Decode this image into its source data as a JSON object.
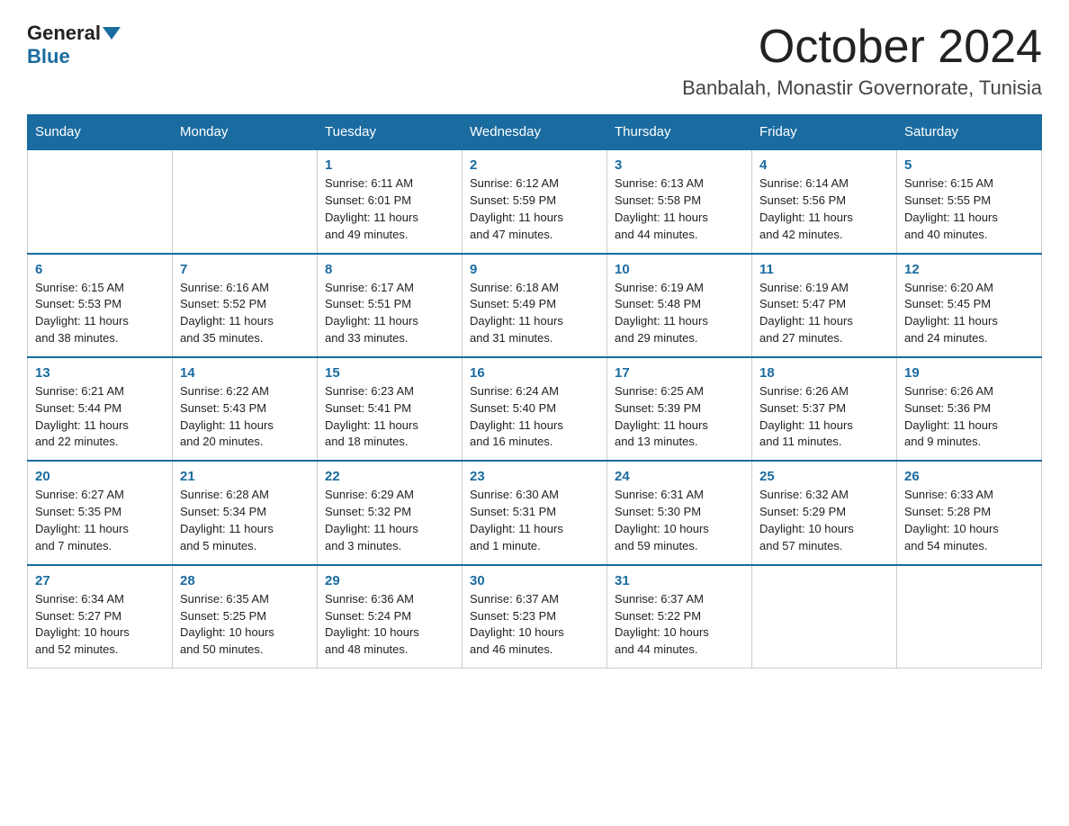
{
  "logo": {
    "general": "General",
    "blue": "Blue"
  },
  "title": "October 2024",
  "location": "Banbalah, Monastir Governorate, Tunisia",
  "days_of_week": [
    "Sunday",
    "Monday",
    "Tuesday",
    "Wednesday",
    "Thursday",
    "Friday",
    "Saturday"
  ],
  "weeks": [
    [
      {
        "num": "",
        "info": ""
      },
      {
        "num": "",
        "info": ""
      },
      {
        "num": "1",
        "info": "Sunrise: 6:11 AM\nSunset: 6:01 PM\nDaylight: 11 hours\nand 49 minutes."
      },
      {
        "num": "2",
        "info": "Sunrise: 6:12 AM\nSunset: 5:59 PM\nDaylight: 11 hours\nand 47 minutes."
      },
      {
        "num": "3",
        "info": "Sunrise: 6:13 AM\nSunset: 5:58 PM\nDaylight: 11 hours\nand 44 minutes."
      },
      {
        "num": "4",
        "info": "Sunrise: 6:14 AM\nSunset: 5:56 PM\nDaylight: 11 hours\nand 42 minutes."
      },
      {
        "num": "5",
        "info": "Sunrise: 6:15 AM\nSunset: 5:55 PM\nDaylight: 11 hours\nand 40 minutes."
      }
    ],
    [
      {
        "num": "6",
        "info": "Sunrise: 6:15 AM\nSunset: 5:53 PM\nDaylight: 11 hours\nand 38 minutes."
      },
      {
        "num": "7",
        "info": "Sunrise: 6:16 AM\nSunset: 5:52 PM\nDaylight: 11 hours\nand 35 minutes."
      },
      {
        "num": "8",
        "info": "Sunrise: 6:17 AM\nSunset: 5:51 PM\nDaylight: 11 hours\nand 33 minutes."
      },
      {
        "num": "9",
        "info": "Sunrise: 6:18 AM\nSunset: 5:49 PM\nDaylight: 11 hours\nand 31 minutes."
      },
      {
        "num": "10",
        "info": "Sunrise: 6:19 AM\nSunset: 5:48 PM\nDaylight: 11 hours\nand 29 minutes."
      },
      {
        "num": "11",
        "info": "Sunrise: 6:19 AM\nSunset: 5:47 PM\nDaylight: 11 hours\nand 27 minutes."
      },
      {
        "num": "12",
        "info": "Sunrise: 6:20 AM\nSunset: 5:45 PM\nDaylight: 11 hours\nand 24 minutes."
      }
    ],
    [
      {
        "num": "13",
        "info": "Sunrise: 6:21 AM\nSunset: 5:44 PM\nDaylight: 11 hours\nand 22 minutes."
      },
      {
        "num": "14",
        "info": "Sunrise: 6:22 AM\nSunset: 5:43 PM\nDaylight: 11 hours\nand 20 minutes."
      },
      {
        "num": "15",
        "info": "Sunrise: 6:23 AM\nSunset: 5:41 PM\nDaylight: 11 hours\nand 18 minutes."
      },
      {
        "num": "16",
        "info": "Sunrise: 6:24 AM\nSunset: 5:40 PM\nDaylight: 11 hours\nand 16 minutes."
      },
      {
        "num": "17",
        "info": "Sunrise: 6:25 AM\nSunset: 5:39 PM\nDaylight: 11 hours\nand 13 minutes."
      },
      {
        "num": "18",
        "info": "Sunrise: 6:26 AM\nSunset: 5:37 PM\nDaylight: 11 hours\nand 11 minutes."
      },
      {
        "num": "19",
        "info": "Sunrise: 6:26 AM\nSunset: 5:36 PM\nDaylight: 11 hours\nand 9 minutes."
      }
    ],
    [
      {
        "num": "20",
        "info": "Sunrise: 6:27 AM\nSunset: 5:35 PM\nDaylight: 11 hours\nand 7 minutes."
      },
      {
        "num": "21",
        "info": "Sunrise: 6:28 AM\nSunset: 5:34 PM\nDaylight: 11 hours\nand 5 minutes."
      },
      {
        "num": "22",
        "info": "Sunrise: 6:29 AM\nSunset: 5:32 PM\nDaylight: 11 hours\nand 3 minutes."
      },
      {
        "num": "23",
        "info": "Sunrise: 6:30 AM\nSunset: 5:31 PM\nDaylight: 11 hours\nand 1 minute."
      },
      {
        "num": "24",
        "info": "Sunrise: 6:31 AM\nSunset: 5:30 PM\nDaylight: 10 hours\nand 59 minutes."
      },
      {
        "num": "25",
        "info": "Sunrise: 6:32 AM\nSunset: 5:29 PM\nDaylight: 10 hours\nand 57 minutes."
      },
      {
        "num": "26",
        "info": "Sunrise: 6:33 AM\nSunset: 5:28 PM\nDaylight: 10 hours\nand 54 minutes."
      }
    ],
    [
      {
        "num": "27",
        "info": "Sunrise: 6:34 AM\nSunset: 5:27 PM\nDaylight: 10 hours\nand 52 minutes."
      },
      {
        "num": "28",
        "info": "Sunrise: 6:35 AM\nSunset: 5:25 PM\nDaylight: 10 hours\nand 50 minutes."
      },
      {
        "num": "29",
        "info": "Sunrise: 6:36 AM\nSunset: 5:24 PM\nDaylight: 10 hours\nand 48 minutes."
      },
      {
        "num": "30",
        "info": "Sunrise: 6:37 AM\nSunset: 5:23 PM\nDaylight: 10 hours\nand 46 minutes."
      },
      {
        "num": "31",
        "info": "Sunrise: 6:37 AM\nSunset: 5:22 PM\nDaylight: 10 hours\nand 44 minutes."
      },
      {
        "num": "",
        "info": ""
      },
      {
        "num": "",
        "info": ""
      }
    ]
  ]
}
